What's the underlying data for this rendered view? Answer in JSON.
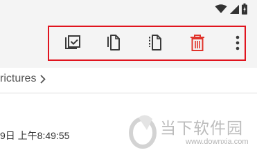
{
  "status_bar": {
    "icons": [
      "wifi-icon",
      "cell-signal-icon",
      "battery-icon"
    ]
  },
  "action_bar": {
    "actions": [
      {
        "name": "select-all",
        "icon": "select-all-icon"
      },
      {
        "name": "copy",
        "icon": "copy-icon"
      },
      {
        "name": "move",
        "icon": "move-icon"
      },
      {
        "name": "delete",
        "icon": "trash-icon"
      },
      {
        "name": "more",
        "icon": "more-vert-icon"
      }
    ],
    "highlight_color": "#e0141e",
    "delete_color": "#e0342b"
  },
  "path": {
    "label": "rictures",
    "chevron_icon": "chevron-right-icon"
  },
  "file_item": {
    "timestamp": "9日 上午8:49:55"
  },
  "watermark": {
    "brand": "当下软件园",
    "url": "www.downxia.com"
  }
}
